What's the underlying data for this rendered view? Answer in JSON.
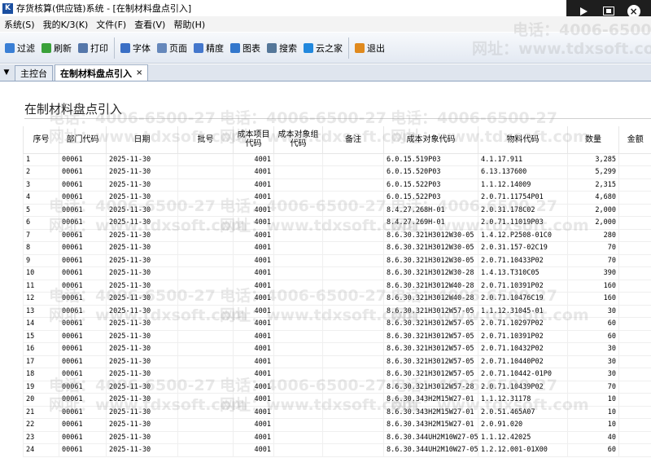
{
  "window": {
    "title": "存货核算(供应链)系统 - [在制材料盘点引入]"
  },
  "menu": [
    "系统(S)",
    "我的K/3(K)",
    "文件(F)",
    "查看(V)",
    "帮助(H)"
  ],
  "toolbar": [
    {
      "label": "过滤",
      "icon": "filter-icon",
      "color": "#3a7fd5"
    },
    {
      "label": "刷新",
      "icon": "refresh-icon",
      "color": "#3aa13a"
    },
    {
      "label": "打印",
      "icon": "print-icon",
      "color": "#5577aa"
    },
    {
      "label": "字体",
      "icon": "font-icon",
      "color": "#3a6fc5"
    },
    {
      "label": "页面",
      "icon": "page-icon",
      "color": "#6688bb"
    },
    {
      "label": "精度",
      "icon": "precision-icon",
      "color": "#4477cc"
    },
    {
      "label": "图表",
      "icon": "chart-icon",
      "color": "#3377cc"
    },
    {
      "label": "搜索",
      "icon": "search-icon",
      "color": "#557799"
    },
    {
      "label": "云之家",
      "icon": "cloud-icon",
      "color": "#2288dd"
    },
    {
      "label": "退出",
      "icon": "exit-icon",
      "color": "#e08a1e"
    }
  ],
  "tabs": [
    {
      "label": "主控台",
      "active": false
    },
    {
      "label": "在制材料盘点引入",
      "active": true
    }
  ],
  "page_title": "在制材料盘点引入",
  "columns": [
    "序号",
    "部门代码",
    "日期",
    "批号",
    "成本项目代码",
    "成本对象组代码",
    "备注",
    "成本对象代码",
    "物料代码",
    "数量",
    "金额"
  ],
  "rows": [
    [
      "1",
      "00061",
      "2025-11-30",
      "",
      "4001",
      "",
      "",
      "6.0.15.519P03",
      "4.1.17.911",
      "3,285",
      ""
    ],
    [
      "2",
      "00061",
      "2025-11-30",
      "",
      "4001",
      "",
      "",
      "6.0.15.520P03",
      "6.13.137600",
      "5,299",
      ""
    ],
    [
      "3",
      "00061",
      "2025-11-30",
      "",
      "4001",
      "",
      "",
      "6.0.15.522P03",
      "1.1.12.14009",
      "2,315",
      ""
    ],
    [
      "4",
      "00061",
      "2025-11-30",
      "",
      "4001",
      "",
      "",
      "6.0.15.522P03",
      "2.0.71.11754P01",
      "4,680",
      ""
    ],
    [
      "5",
      "00061",
      "2025-11-30",
      "",
      "4001",
      "",
      "",
      "8.4.27.268H-01",
      "2.0.31.178C02",
      "2,000",
      ""
    ],
    [
      "6",
      "00061",
      "2025-11-30",
      "",
      "4001",
      "",
      "",
      "8.4.27.269H-01",
      "2.0.71.11019P03",
      "2,000",
      ""
    ],
    [
      "7",
      "00061",
      "2025-11-30",
      "",
      "4001",
      "",
      "",
      "8.6.30.321H3012W30-05",
      "1.4.12.P2508-01C0",
      "280",
      ""
    ],
    [
      "8",
      "00061",
      "2025-11-30",
      "",
      "4001",
      "",
      "",
      "8.6.30.321H3012W30-05",
      "2.0.31.157-02C19",
      "70",
      ""
    ],
    [
      "9",
      "00061",
      "2025-11-30",
      "",
      "4001",
      "",
      "",
      "8.6.30.321H3012W30-05",
      "2.0.71.10433P02",
      "70",
      ""
    ],
    [
      "10",
      "00061",
      "2025-11-30",
      "",
      "4001",
      "",
      "",
      "8.6.30.321H3012W30-28",
      "1.4.13.T310C05",
      "390",
      ""
    ],
    [
      "11",
      "00061",
      "2025-11-30",
      "",
      "4001",
      "",
      "",
      "8.6.30.321H3012W40-28",
      "2.0.71.10391P02",
      "160",
      ""
    ],
    [
      "12",
      "00061",
      "2025-11-30",
      "",
      "4001",
      "",
      "",
      "8.6.30.321H3012W40-28",
      "2.0.71.10476C19",
      "160",
      ""
    ],
    [
      "13",
      "00061",
      "2025-11-30",
      "",
      "4001",
      "",
      "",
      "8.6.30.321H3012W57-05",
      "1.1.12.31045-01",
      "30",
      ""
    ],
    [
      "14",
      "00061",
      "2025-11-30",
      "",
      "4001",
      "",
      "",
      "8.6.30.321H3012W57-05",
      "2.0.71.10297P02",
      "60",
      ""
    ],
    [
      "15",
      "00061",
      "2025-11-30",
      "",
      "4001",
      "",
      "",
      "8.6.30.321H3012W57-05",
      "2.0.71.10391P02",
      "60",
      ""
    ],
    [
      "16",
      "00061",
      "2025-11-30",
      "",
      "4001",
      "",
      "",
      "8.6.30.321H3012W57-05",
      "2.0.71.10432P02",
      "30",
      ""
    ],
    [
      "17",
      "00061",
      "2025-11-30",
      "",
      "4001",
      "",
      "",
      "8.6.30.321H3012W57-05",
      "2.0.71.10440P02",
      "30",
      ""
    ],
    [
      "18",
      "00061",
      "2025-11-30",
      "",
      "4001",
      "",
      "",
      "8.6.30.321H3012W57-05",
      "2.0.71.10442-01P0",
      "30",
      ""
    ],
    [
      "19",
      "00061",
      "2025-11-30",
      "",
      "4001",
      "",
      "",
      "8.6.30.321H3012W57-28",
      "2.0.71.10439P02",
      "70",
      ""
    ],
    [
      "20",
      "00061",
      "2025-11-30",
      "",
      "4001",
      "",
      "",
      "8.6.30.343H2M15W27-01",
      "1.1.12.31178",
      "10",
      ""
    ],
    [
      "21",
      "00061",
      "2025-11-30",
      "",
      "4001",
      "",
      "",
      "8.6.30.343H2M15W27-01",
      "2.0.51.465A07",
      "10",
      ""
    ],
    [
      "22",
      "00061",
      "2025-11-30",
      "",
      "4001",
      "",
      "",
      "8.6.30.343H2M15W27-01",
      "2.0.91.020",
      "10",
      ""
    ],
    [
      "23",
      "00061",
      "2025-11-30",
      "",
      "4001",
      "",
      "",
      "8.6.30.344UH2M10W27-05",
      "1.1.12.42025",
      "40",
      ""
    ],
    [
      "24",
      "00061",
      "2025-11-30",
      "",
      "4001",
      "",
      "",
      "8.6.30.344UH2M10W27-05",
      "1.2.12.001-01X00",
      "60",
      ""
    ]
  ],
  "watermark": {
    "phone": "电话：4006-6500-27",
    "site": "网址：www.tdxsoft.com"
  }
}
